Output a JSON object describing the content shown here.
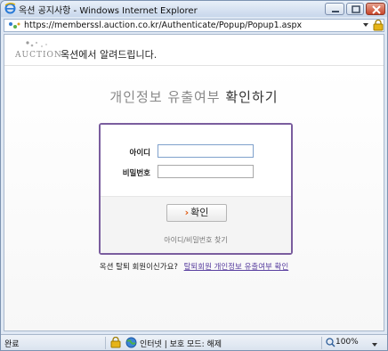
{
  "window": {
    "title": "옥션 공지사항 - Windows Internet Explorer",
    "url": "https://memberssl.auction.co.kr/Authenticate/Popup/Popup1.aspx"
  },
  "header": {
    "logo_text": "AUCTION",
    "notice_text": "옥션에서 알려드립니다."
  },
  "main": {
    "title_light": "개인정보 유출여부",
    "title_dark": "확인하기"
  },
  "login": {
    "id_label": "아이디",
    "password_label": "비밀번호",
    "id_value": "",
    "password_value": "",
    "confirm_label": "확인",
    "find_link": "아이디/비밀번호 찾기"
  },
  "withdraw": {
    "question": "옥션 탈퇴 회원이신가요?",
    "link": "탈퇴회원 개인정보 유출여부 확인"
  },
  "status": {
    "done": "완료",
    "zone": "인터넷 | 보호 모드: 해제",
    "zoom": "100%"
  },
  "colors": {
    "box_border": "#7a5d9e",
    "link": "#5a40a0",
    "arrow": "#e05a12"
  },
  "icons": [
    "ie-icon",
    "minimize-icon",
    "maximize-icon",
    "close-icon",
    "page-icon",
    "dropdown-icon",
    "lock-icon",
    "globe-icon",
    "zoom-icon"
  ]
}
